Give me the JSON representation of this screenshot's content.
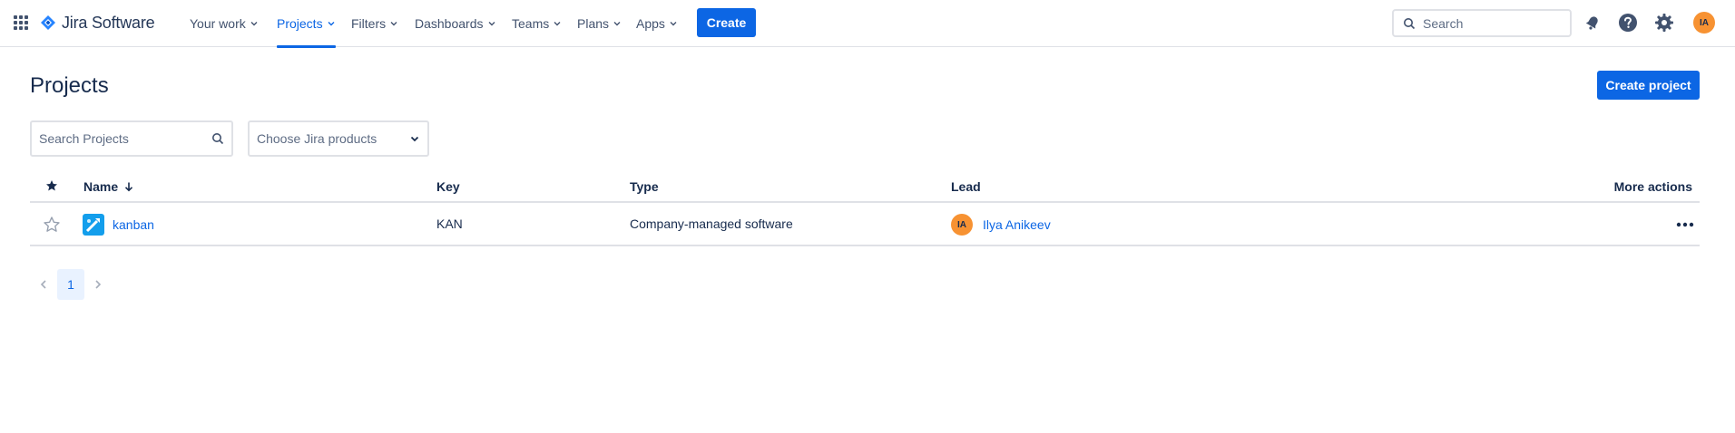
{
  "app": {
    "brand": "Jira Software"
  },
  "nav": {
    "items": [
      {
        "label": "Your work"
      },
      {
        "label": "Projects"
      },
      {
        "label": "Filters"
      },
      {
        "label": "Dashboards"
      },
      {
        "label": "Teams"
      },
      {
        "label": "Plans"
      },
      {
        "label": "Apps"
      }
    ],
    "active": "Projects",
    "create_label": "Create",
    "search_placeholder": "Search",
    "user_initials": "IA"
  },
  "page": {
    "title": "Projects",
    "create_project_label": "Create project",
    "search_placeholder": "Search Projects",
    "product_select_placeholder": "Choose Jira products"
  },
  "table": {
    "columns": {
      "name": "Name",
      "key": "Key",
      "type": "Type",
      "lead": "Lead",
      "more": "More actions"
    },
    "sort": "Name descending",
    "rows": [
      {
        "starred": false,
        "name": "kanban",
        "key": "KAN",
        "type": "Company-managed software",
        "lead_initials": "IA",
        "lead": "Ilya Anikeev"
      }
    ]
  },
  "pagination": {
    "current": "1"
  },
  "colors": {
    "primary": "#0c66e4",
    "avatar": "#f79232",
    "border": "#dfe1e6",
    "text": "#172b4d"
  }
}
